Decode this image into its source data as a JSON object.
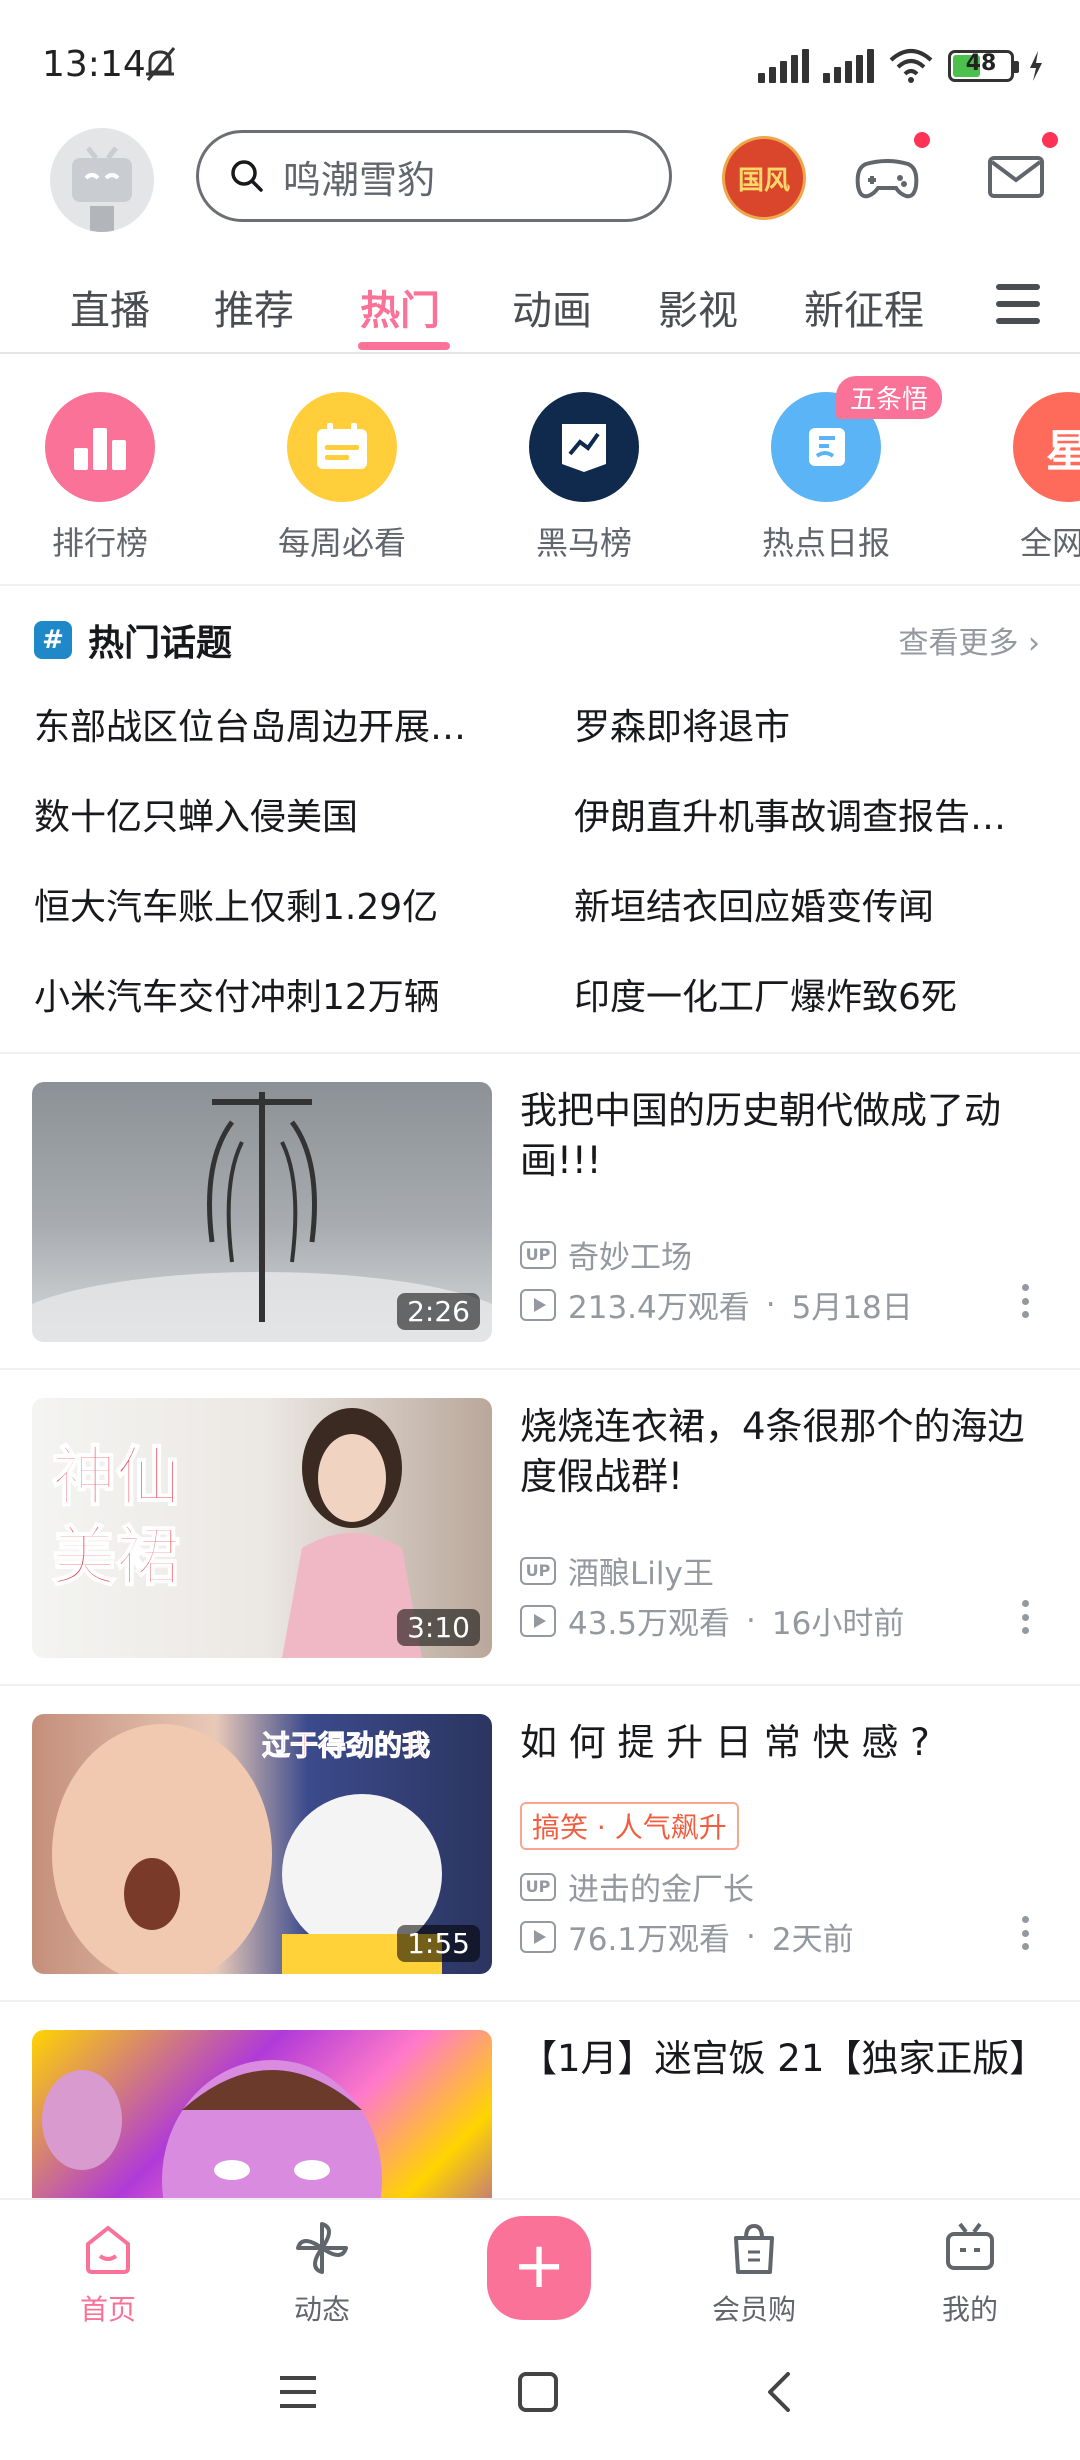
{
  "status_bar": {
    "time": "13:14",
    "battery": "48"
  },
  "header": {
    "search_placeholder": "鸣潮雪豹",
    "event_icon_text": "国风"
  },
  "tabs": [
    {
      "label": "直播"
    },
    {
      "label": "推荐"
    },
    {
      "label": "热门"
    },
    {
      "label": "动画"
    },
    {
      "label": "影视"
    },
    {
      "label": "新征程"
    }
  ],
  "quick_entries": [
    {
      "label": "排行榜",
      "color": "#fb7299"
    },
    {
      "label": "每周必看",
      "color": "#ffce3a"
    },
    {
      "label": "黑马榜",
      "color": "#102a4d"
    },
    {
      "label": "热点日报",
      "color": "#5ab4f5",
      "badge": "五条悟"
    },
    {
      "label": "全网热",
      "color": "#ff6b5a",
      "icon_text": "星"
    }
  ],
  "hot_topics": {
    "title": "热门话题",
    "see_more": "查看更多 ›",
    "items": [
      "东部战区位台岛周边开展…",
      "罗森即将退市",
      "数十亿只蝉入侵美国",
      "伊朗直升机事故调查报告…",
      "恒大汽车账上仅剩1.29亿",
      "新垣结衣回应婚变传闻",
      "小米汽车交付冲刺12万辆",
      "印度一化工厂爆炸致6死"
    ]
  },
  "videos": [
    {
      "title": "我把中国的历史朝代做成了动画!!!",
      "uploader": "奇妙工场",
      "views": "213.4万观看",
      "time": "5月18日",
      "duration": "2:26",
      "tag": ""
    },
    {
      "title": "烧烧连衣裙，4条很那个的海边度假战群!",
      "uploader": "酒酿Lily王",
      "views": "43.5万观看",
      "time": "16小时前",
      "duration": "3:10",
      "tag": "",
      "thumb_text": "神仙美裙"
    },
    {
      "title": "如 何 提 升 日 常 快 感 ?",
      "uploader": "进击的金厂长",
      "views": "76.1万观看",
      "time": "2天前",
      "duration": "1:55",
      "tag": "搞笑 · 人气飙升",
      "thumb_text": "过于得劲的我"
    },
    {
      "title": "【1月】迷宫饭 21【独家正版】",
      "uploader": "",
      "views": "",
      "time": "",
      "duration": "",
      "tag": ""
    }
  ],
  "bottom_nav": [
    {
      "label": "首页"
    },
    {
      "label": "动态"
    },
    {
      "label": "+"
    },
    {
      "label": "会员购"
    },
    {
      "label": "我的"
    }
  ],
  "colors": {
    "accent": "#fb7299",
    "text_secondary": "#9499a0"
  }
}
